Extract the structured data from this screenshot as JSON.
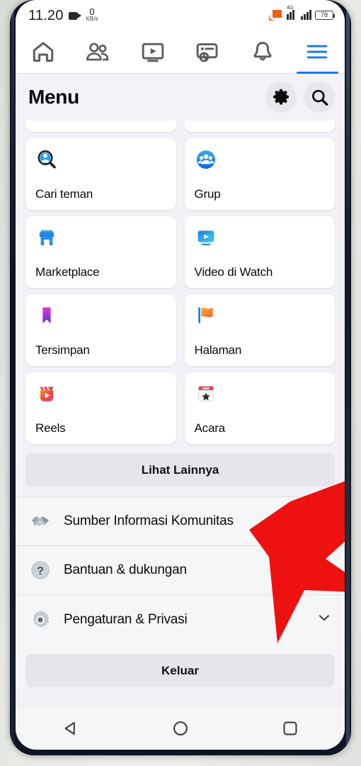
{
  "statusbar": {
    "time": "11.20",
    "camera_icon": "video-camera-icon",
    "data_speed_value": "0",
    "data_speed_unit": "KB/s",
    "cast_icon": "screen-cast-icon",
    "network_type": "4G",
    "signal_icon": "signal-bars-icon",
    "battery_level": "78"
  },
  "topnav": {
    "tabs": [
      {
        "name": "home",
        "icon": "home-icon",
        "active": false
      },
      {
        "name": "friends",
        "icon": "friends-icon",
        "active": false
      },
      {
        "name": "watch",
        "icon": "video-watch-icon",
        "active": false
      },
      {
        "name": "marketplace",
        "icon": "marketplace-card-icon",
        "active": false
      },
      {
        "name": "notifications",
        "icon": "bell-icon",
        "active": false
      },
      {
        "name": "menu",
        "icon": "hamburger-menu-icon",
        "active": true
      }
    ]
  },
  "header": {
    "title": "Menu",
    "settings_icon": "gear-icon",
    "search_icon": "search-icon"
  },
  "shortcuts": {
    "tiles": [
      {
        "label": "Cari teman",
        "icon": "find-friends-icon"
      },
      {
        "label": "Grup",
        "icon": "groups-icon"
      },
      {
        "label": "Marketplace",
        "icon": "marketplace-store-icon"
      },
      {
        "label": "Video di Watch",
        "icon": "watch-video-icon"
      },
      {
        "label": "Tersimpan",
        "icon": "bookmark-saved-icon"
      },
      {
        "label": "Halaman",
        "icon": "pages-flag-icon"
      },
      {
        "label": "Reels",
        "icon": "reels-icon"
      },
      {
        "label": "Acara",
        "icon": "events-calendar-icon"
      }
    ],
    "see_more_label": "Lihat Lainnya"
  },
  "list": {
    "rows": [
      {
        "label": "Sumber Informasi Komunitas",
        "icon": "handshake-icon",
        "chevron": false
      },
      {
        "label": "Bantuan & dukungan",
        "icon": "help-question-icon",
        "chevron": true
      },
      {
        "label": "Pengaturan & Privasi",
        "icon": "settings-gear-icon",
        "chevron": true
      }
    ]
  },
  "logout": {
    "label": "Keluar"
  },
  "navbar": {
    "back_icon": "android-back-icon",
    "home_icon": "android-home-icon",
    "recents_icon": "android-recents-icon"
  },
  "annotation": {
    "arrow_icon": "red-arrow-annotation",
    "arrow_color": "#ee1111",
    "points_at": "Pengaturan & Privasi"
  },
  "colors": {
    "accent_blue": "#1877f2",
    "page_bg": "#f0f2f5",
    "card_bg": "#ffffff",
    "button_bg": "#e4e6eb"
  }
}
